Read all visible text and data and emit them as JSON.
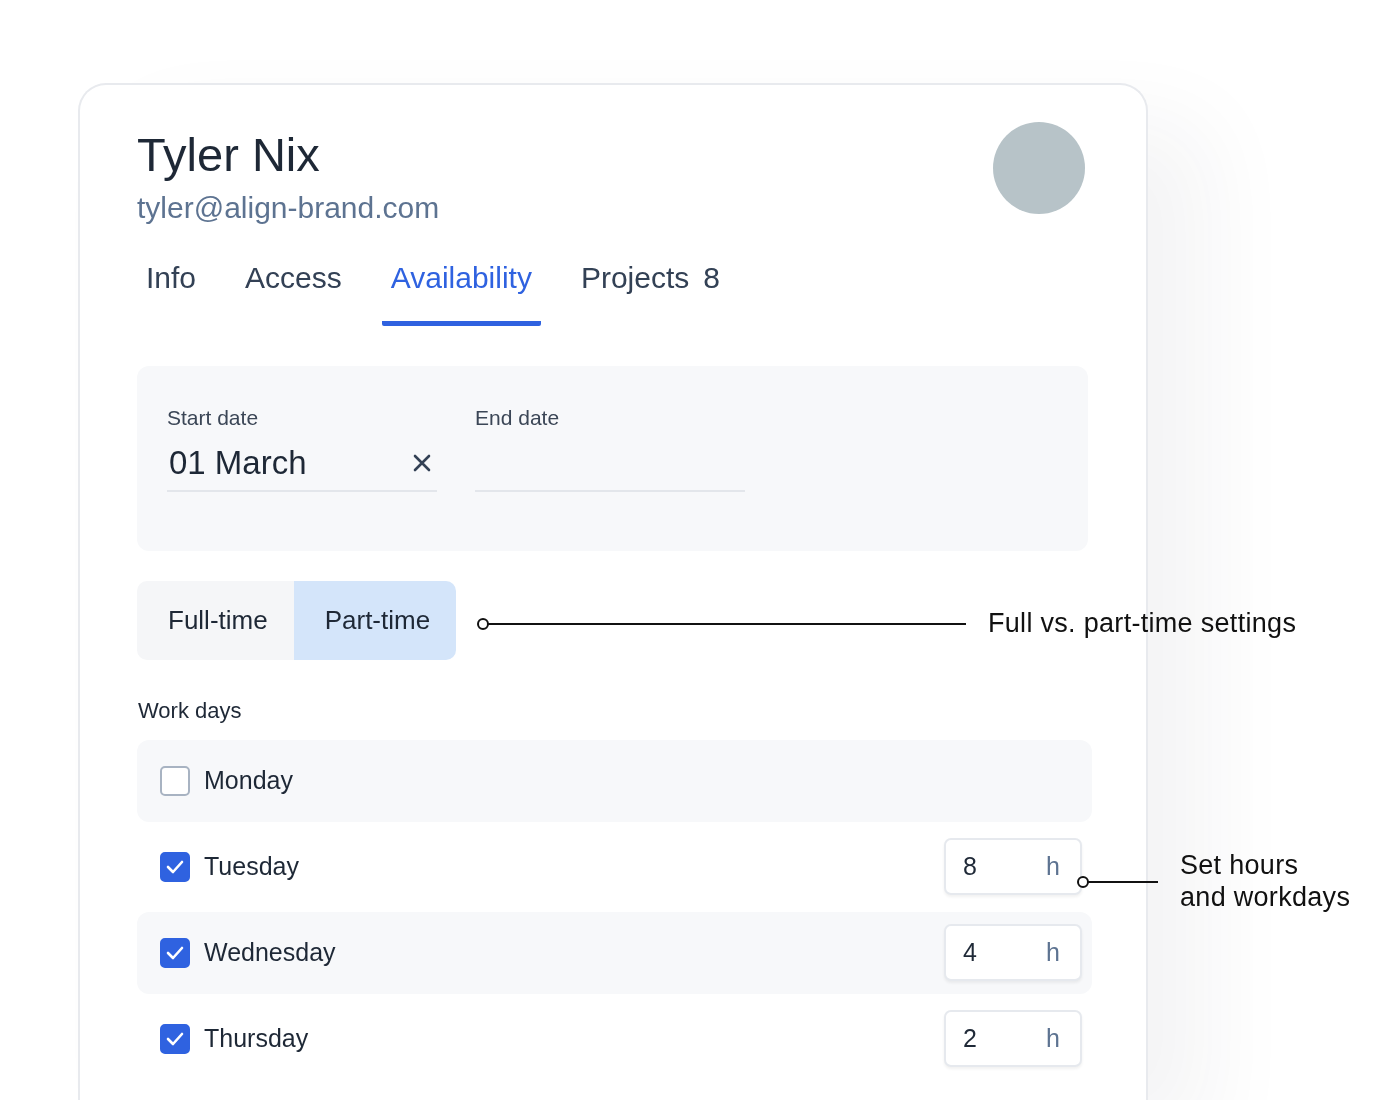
{
  "profile": {
    "name": "Tyler Nix",
    "email": "tyler@align-brand.com"
  },
  "tabs": [
    {
      "label": "Info",
      "selected": false
    },
    {
      "label": "Access",
      "selected": false
    },
    {
      "label": "Availability",
      "selected": true
    },
    {
      "label": "Projects",
      "count": "8",
      "selected": false
    }
  ],
  "dates": {
    "start": {
      "label": "Start date",
      "value": "01 March"
    },
    "end": {
      "label": "End date"
    }
  },
  "schedule_toggle": [
    {
      "label": "Full-time",
      "selected": false
    },
    {
      "label": "Part-time",
      "selected": true
    }
  ],
  "work_days": {
    "label": "Work days",
    "days": [
      {
        "name": "Monday",
        "checked": false
      },
      {
        "name": "Tuesday",
        "checked": true,
        "hours": "8",
        "unit": "h"
      },
      {
        "name": "Wednesday",
        "checked": true,
        "hours": "4",
        "unit": "h"
      },
      {
        "name": "Thursday",
        "checked": true,
        "hours": "2",
        "unit": "h"
      }
    ]
  },
  "annotations": [
    {
      "text": "Full vs. part-time settings"
    },
    {
      "text": "Set hours\nand workdays"
    }
  ]
}
